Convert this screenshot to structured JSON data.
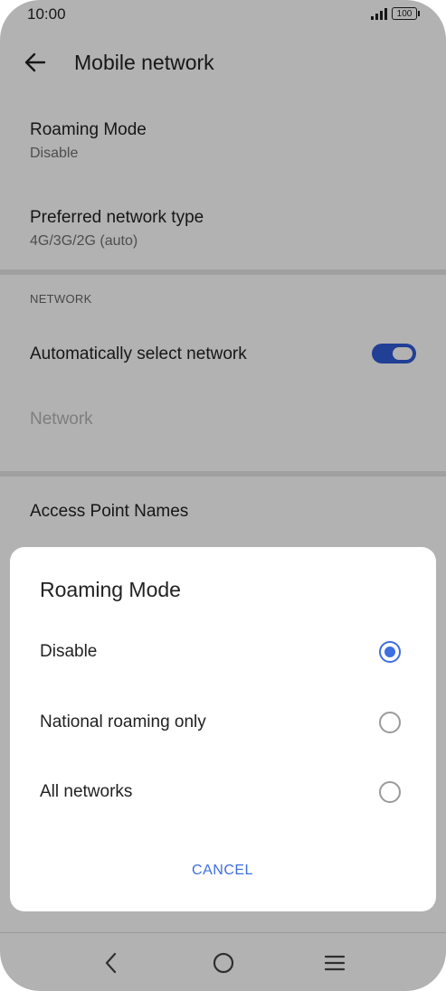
{
  "status_bar": {
    "time": "10:00",
    "battery": "100"
  },
  "app_bar": {
    "title": "Mobile network",
    "back_icon": "arrow-left-icon"
  },
  "settings": {
    "roaming_mode": {
      "title": "Roaming Mode",
      "value": "Disable"
    },
    "preferred_network_type": {
      "title": "Preferred network type",
      "value": "4G/3G/2G (auto)"
    },
    "section_network": "NETWORK",
    "auto_select": {
      "title": "Automatically select network",
      "enabled": true
    },
    "network": {
      "title": "Network"
    },
    "apn": {
      "title": "Access Point Names"
    }
  },
  "dialog": {
    "title": "Roaming Mode",
    "options": [
      {
        "label": "Disable",
        "selected": true
      },
      {
        "label": "National roaming only",
        "selected": false
      },
      {
        "label": "All networks",
        "selected": false
      }
    ],
    "cancel_label": "CANCEL"
  },
  "colors": {
    "accent": "#3d6fe0",
    "toggle_on": "#2f5bd6",
    "scrim": "rgba(0,0,0,0.30)"
  },
  "nav_icons": [
    "back-triangle-icon",
    "home-circle-icon",
    "menu-lines-icon"
  ]
}
